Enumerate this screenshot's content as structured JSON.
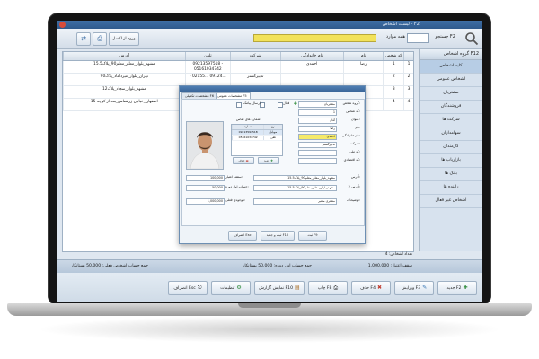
{
  "window": {
    "title": "لیست اشخاص - F2"
  },
  "toolbar": {
    "code_label": "جستجو F2",
    "code_value": "",
    "search_label": "همه موارد",
    "import_label": "ورود از اکسل",
    "print_icon": "printer-icon",
    "export_icon": "export-icon"
  },
  "sidebar": {
    "header": "گروه اشخاص F12",
    "items": [
      {
        "label": "کلیه اشخاص",
        "active": true
      },
      {
        "label": "اشخاص عمومی",
        "active": false
      },
      {
        "label": "مشتریان",
        "active": false
      },
      {
        "label": "فروشندگان",
        "active": false
      },
      {
        "label": "شرکت ها",
        "active": false
      },
      {
        "label": "سهامداران",
        "active": false
      },
      {
        "label": "کارمندان",
        "active": false
      },
      {
        "label": "بازاریاب ها",
        "active": false
      },
      {
        "label": "بانک ها",
        "active": false
      },
      {
        "label": "راننده ها",
        "active": false
      },
      {
        "label": "اشخاص غیر فعال",
        "active": false
      }
    ]
  },
  "grid": {
    "columns": {
      "num": "",
      "code": "کد شخص",
      "name": "نام",
      "family": "نام خانوادگی",
      "company": "شرکت",
      "phone": "تلفن",
      "address": "آدرس"
    },
    "rows": [
      {
        "num": "1",
        "code": "1",
        "name": "رضا",
        "family": "احمدی",
        "company": "",
        "phone": "09213597518 - 05161034742",
        "address": "مشهد_بلوار_معلم_معلم90_پلاک15.5"
      },
      {
        "num": "2",
        "code": "2",
        "name": "",
        "family": "",
        "company": "تدبیرگستر",
        "phone": "- 02155... 09124...",
        "address": "تهران_بلوار_میرداماد_پلاک90"
      },
      {
        "num": "3",
        "code": "3",
        "name": "",
        "family": "",
        "company": "",
        "phone": "- 05130... 09213...",
        "address": "مشهد_بلوار_سجاد_پلاک12"
      },
      {
        "num": "4",
        "code": "4",
        "name": "",
        "family": "",
        "company": "",
        "phone": "- 05125... 09215...",
        "address": "اصفهان_خیابان زرشناس_بعد از کوچه 15"
      }
    ],
    "footer": "تعداد اشخاص: 4"
  },
  "summary": {
    "balance_label": "سقف اعتبار: 1,000,000",
    "debit": "جمع حساب اول دوره: 50,000 بستانکار",
    "credit": "جمع حساب اشخاص فعلی: 50,000 بستانکار"
  },
  "bottom_buttons": {
    "new": "جدید F2",
    "edit": "ویرایش F3",
    "delete": "حذف F4",
    "print": "چاپ F8",
    "report": "نمایش گزارش F10",
    "settings": "تنظیمات",
    "exit": "انصراف Esc"
  },
  "dialog": {
    "tabs": [
      "مشخصات عمومی F5",
      "مشخصات تکمیلی F6"
    ],
    "fields": {
      "group_label": "گروه شخص:",
      "group_value": "مشتریان",
      "code_label": "کد شخص:",
      "code_value": "1",
      "title_label": "عنوان:",
      "title_value": "آقای",
      "name_label": "نام:",
      "name_value": "رضا",
      "family_label": "نام خانوادگی:",
      "family_value": "احمدی",
      "company_label": "شرکت:",
      "company_value": "تدبیرگستر",
      "nationalcode_label": "کد ملی:",
      "nationalcode_value": "",
      "economic_label": "کد اقتصادی:",
      "economic_value": "",
      "address1_label": "آدرس:",
      "address1_value": "مشهد_بلوار_معلم_معلم90_پلاک15.5",
      "address2_label": "آدرس 2:",
      "address2_value": "مشهد_بلوار_معلم_معلم90_پلاک15.5",
      "desc_label": "توضیحات:",
      "desc_value": "مشتری معتبر",
      "credit_label": "سقف اعتبار:",
      "credit_value": "100,000",
      "opening_label": "حساب اول دوره:",
      "opening_value": "50,000",
      "current_label": "موجودی فعلی:",
      "current_value": "1,000,000",
      "active_label": "فعال",
      "sms_label": "ارسال پیامک",
      "phone_section": "شماره های تماس"
    },
    "mini_grid": {
      "columns": [
        "نوع",
        "شماره"
      ],
      "rows": [
        [
          "موبایل",
          "09213597518"
        ],
        [
          "تلفن",
          "05161034742"
        ]
      ],
      "add_label": "جدید",
      "remove_label": "حذف"
    },
    "footer": {
      "save": "ثبت F9",
      "save_new": "ثبت و جدید F10",
      "cancel": "انصراف Esc"
    }
  }
}
